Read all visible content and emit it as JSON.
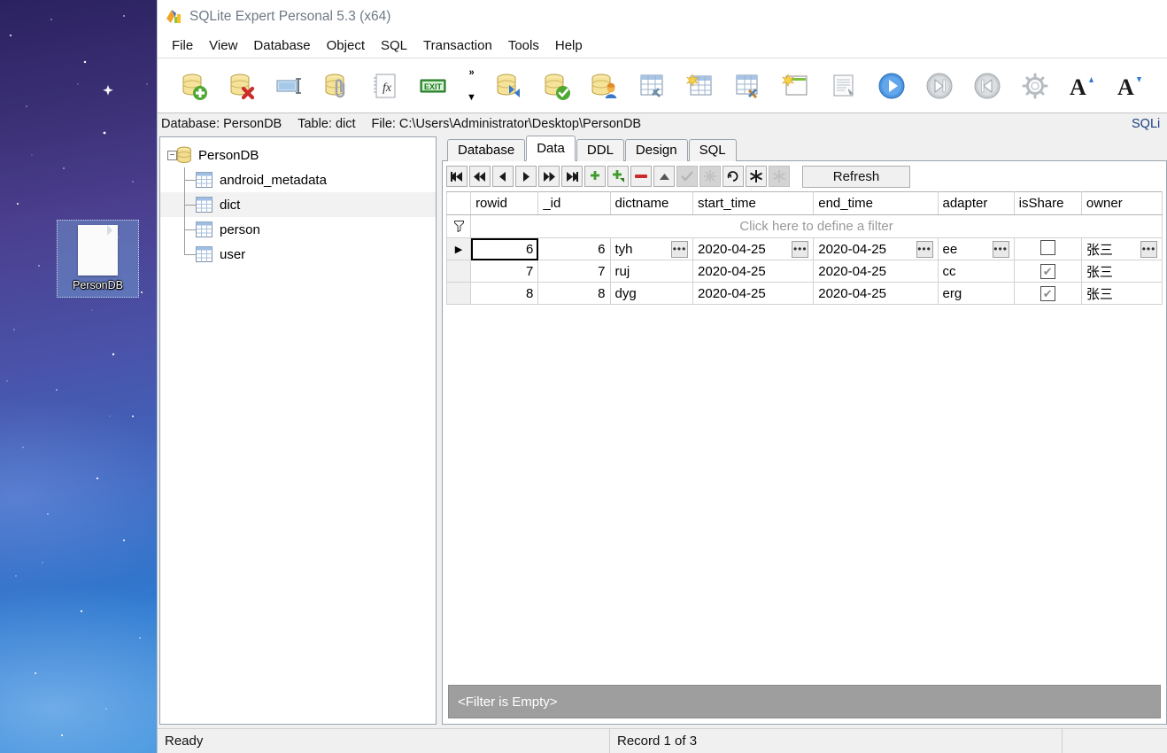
{
  "desktop": {
    "icon": {
      "label": "PersonDB",
      "icon": "file-document-icon"
    }
  },
  "window": {
    "title": "SQLite Expert Personal 5.3 (x64)",
    "app_icon": "sqlite-expert-logo-icon",
    "menu": [
      "File",
      "View",
      "Database",
      "Object",
      "SQL",
      "Transaction",
      "Tools",
      "Help"
    ],
    "toolbar": {
      "overflow_chevron": "»",
      "overflow_arrow": "▼",
      "buttons": [
        {
          "name": "new-database-icon",
          "tip": "New Database"
        },
        {
          "name": "delete-database-icon",
          "tip": "Delete Database"
        },
        {
          "name": "rename-database-icon",
          "tip": "Rename Database"
        },
        {
          "name": "attach-database-icon",
          "tip": "Attach Database"
        },
        {
          "name": "functions-icon",
          "tip": "Functions"
        },
        {
          "name": "exit-icon",
          "tip": "Exit"
        },
        {
          "name": "refresh-database-icon",
          "tip": "Refresh Database"
        },
        {
          "name": "verify-database-icon",
          "tip": "Verify Database"
        },
        {
          "name": "database-user-icon",
          "tip": "Database User"
        },
        {
          "name": "table-tools-icon",
          "tip": "Table Tools"
        },
        {
          "name": "new-table-icon",
          "tip": "New Table"
        },
        {
          "name": "design-table-icon",
          "tip": "Design Table"
        },
        {
          "name": "new-window-icon",
          "tip": "New Window"
        },
        {
          "name": "script-icon",
          "tip": "Script"
        },
        {
          "name": "execute-icon",
          "tip": "Execute"
        },
        {
          "name": "step-forward-icon",
          "tip": "Step Forward"
        },
        {
          "name": "step-back-icon",
          "tip": "Step Back"
        },
        {
          "name": "options-gear-icon",
          "tip": "Options"
        },
        {
          "name": "font-increase-icon",
          "tip": "Increase Font"
        },
        {
          "name": "font-decrease-icon",
          "tip": "Decrease Font"
        }
      ]
    },
    "infobar": {
      "database": "Database: PersonDB",
      "table": "Table: dict",
      "file": "File: C:\\Users\\Administrator\\Desktop\\PersonDB",
      "right_clipped": "SQLi"
    }
  },
  "tree": {
    "root": {
      "label": "PersonDB",
      "icon": "database-icon",
      "expanded": true,
      "expander": "−"
    },
    "children": [
      {
        "label": "android_metadata",
        "icon": "table-icon",
        "selected": false
      },
      {
        "label": "dict",
        "icon": "table-icon",
        "selected": true
      },
      {
        "label": "person",
        "icon": "table-icon",
        "selected": false
      },
      {
        "label": "user",
        "icon": "table-icon",
        "selected": false
      }
    ]
  },
  "tabs": [
    {
      "label": "Database",
      "active": false
    },
    {
      "label": "Data",
      "active": true
    },
    {
      "label": "DDL",
      "active": false
    },
    {
      "label": "Design",
      "active": false
    },
    {
      "label": "SQL",
      "active": false
    }
  ],
  "grid_toolbar": {
    "buttons": [
      {
        "name": "first-record-button",
        "glyph": "⏮",
        "state": "enabled"
      },
      {
        "name": "prior-page-button",
        "glyph": "⏪",
        "state": "enabled"
      },
      {
        "name": "prior-record-button",
        "glyph": "◀",
        "state": "enabled"
      },
      {
        "name": "next-record-button",
        "glyph": "▶",
        "state": "enabled"
      },
      {
        "name": "next-page-button",
        "glyph": "⏩",
        "state": "enabled"
      },
      {
        "name": "last-record-button",
        "glyph": "⏭",
        "state": "enabled"
      },
      {
        "name": "insert-record-button",
        "glyph": "+",
        "state": "enabled"
      },
      {
        "name": "duplicate-record-button",
        "glyph": "+",
        "state": "enabled"
      },
      {
        "name": "delete-record-button",
        "glyph": "−",
        "state": "enabled"
      },
      {
        "name": "edit-record-button",
        "glyph": "▲",
        "state": "enabled"
      },
      {
        "name": "post-edit-button",
        "glyph": "✔",
        "state": "disabled"
      },
      {
        "name": "cancel-edit-button",
        "glyph": "✖",
        "state": "disabled"
      },
      {
        "name": "refresh-record-button",
        "glyph": "↺",
        "state": "enabled"
      },
      {
        "name": "set-null-button",
        "glyph": "✱",
        "state": "enabled"
      },
      {
        "name": "clear-null-button",
        "glyph": "✱",
        "state": "disabled"
      }
    ],
    "refresh_label": "Refresh"
  },
  "data_grid": {
    "filter_prompt": "Click here to define a filter",
    "filter_glyph": "funnel-icon",
    "columns": [
      "rowid",
      "_id",
      "dictname",
      "start_time",
      "end_time",
      "adapter",
      "isShare",
      "owner"
    ],
    "rows": [
      {
        "selected": true,
        "rowid": "6",
        "_id": "6",
        "dictname": "tyh",
        "start_time": "2020-04-25",
        "end_time": "2020-04-25",
        "adapter": "ee",
        "isShare": false,
        "owner": "张三"
      },
      {
        "selected": false,
        "rowid": "7",
        "_id": "7",
        "dictname": "ruj",
        "start_time": "2020-04-25",
        "end_time": "2020-04-25",
        "adapter": "cc",
        "isShare": true,
        "owner": "张三"
      },
      {
        "selected": false,
        "rowid": "8",
        "_id": "8",
        "dictname": "dyg",
        "start_time": "2020-04-25",
        "end_time": "2020-04-25",
        "adapter": "erg",
        "isShare": true,
        "owner": "张三"
      }
    ],
    "ellipsis_glyph": "•••",
    "check_glyph": "✔",
    "row_indicator_glyph": "▶"
  },
  "filter_bar": {
    "text": "<Filter is Empty>"
  },
  "statusbar": {
    "left": "Ready",
    "middle": "Record 1 of 3",
    "right": ""
  },
  "colors": {
    "accent_blue": "#2f7ad0",
    "filter_bar_bg": "#9e9e9e",
    "tree_selected": "#f2f2f2",
    "title_text": "#6f7a86"
  }
}
